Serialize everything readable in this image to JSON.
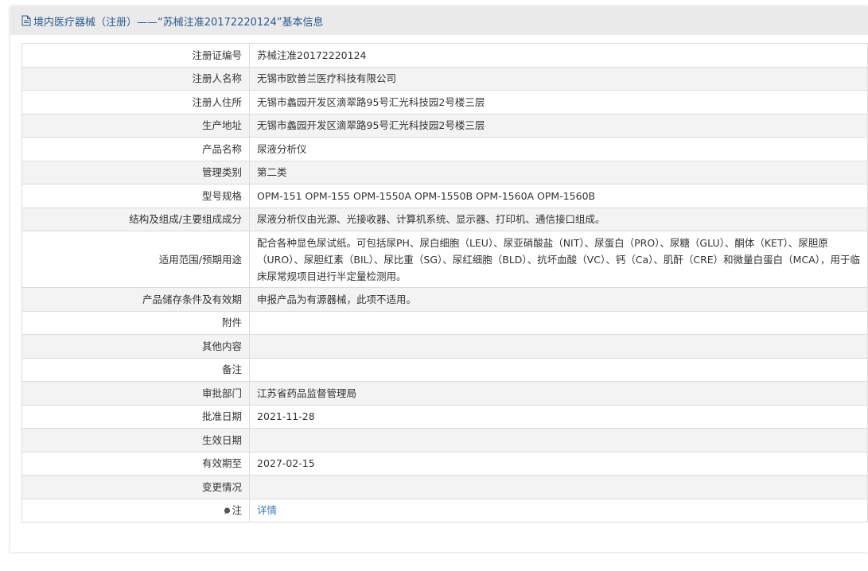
{
  "header": {
    "title": "境内医疗器械（注册）——“苏械注准20172220124”基本信息",
    "icon": "document-icon"
  },
  "rows": [
    {
      "label": "注册证编号",
      "value": "苏械注准20172220124"
    },
    {
      "label": "注册人名称",
      "value": "无锡市欧普兰医疗科技有限公司"
    },
    {
      "label": "注册人住所",
      "value": "无锡市蠡园开发区滴翠路95号汇光科技园2号楼三层"
    },
    {
      "label": "生产地址",
      "value": "无锡市蠡园开发区滴翠路95号汇光科技园2号楼三层"
    },
    {
      "label": "产品名称",
      "value": "尿液分析仪"
    },
    {
      "label": "管理类别",
      "value": "第二类"
    },
    {
      "label": "型号规格",
      "value": "OPM-151 OPM-155 OPM-1550A OPM-1550B OPM-1560A OPM-1560B"
    },
    {
      "label": "结构及组成/主要组成成分",
      "value": "尿液分析仪由光源、光接收器、计算机系统、显示器、打印机、通信接口组成。"
    },
    {
      "label": "适用范围/预期用途",
      "value": "配合各种显色尿试纸。可包括尿PH、尿白细胞（LEU）、尿亚硝酸盐（NIT）、尿蛋白（PRO）、尿糖（GLU）、酮体（KET）、尿胆原（URO）、尿胆红素（BIL）、尿比重（SG）、尿红细胞（BLD）、抗坏血酸（VC）、钙（Ca）、肌酐（CRE）和微量白蛋白（MCA），用于临床尿常规项目进行半定量检测用。"
    },
    {
      "label": "产品储存条件及有效期",
      "value": "申报产品为有源器械，此项不适用。"
    },
    {
      "label": "附件",
      "value": ""
    },
    {
      "label": "其他内容",
      "value": ""
    },
    {
      "label": "备注",
      "value": ""
    },
    {
      "label": "审批部门",
      "value": "江苏省药品监督管理局"
    },
    {
      "label": "批准日期",
      "value": "2021-11-28"
    },
    {
      "label": "生效日期",
      "value": ""
    },
    {
      "label": "有效期至",
      "value": "2027-02-15"
    },
    {
      "label": "变更情况",
      "value": ""
    }
  ],
  "note": {
    "label": "注",
    "icon": "pin-icon",
    "link": "详情"
  },
  "colors": {
    "header_bg": "#eaeaea",
    "header_text": "#2a5b8f",
    "link": "#3a7cc3",
    "alt_row": "#f3f3f3",
    "border": "#dcdcdc"
  }
}
